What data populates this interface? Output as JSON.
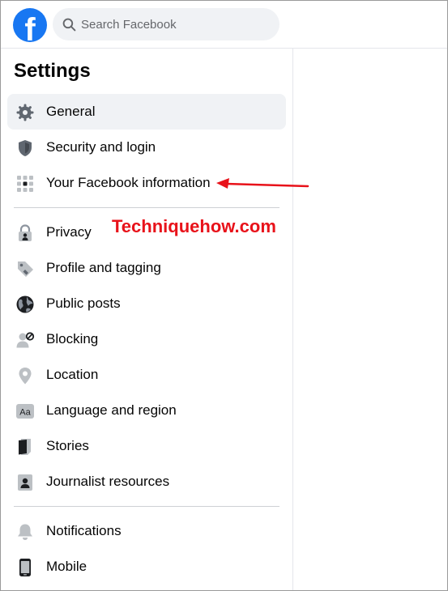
{
  "search": {
    "placeholder": "Search Facebook"
  },
  "sidebar": {
    "title": "Settings",
    "items": [
      {
        "label": "General"
      },
      {
        "label": "Security and login"
      },
      {
        "label": "Your Facebook information"
      },
      {
        "label": "Privacy"
      },
      {
        "label": "Profile and tagging"
      },
      {
        "label": "Public posts"
      },
      {
        "label": "Blocking"
      },
      {
        "label": "Location"
      },
      {
        "label": "Language and region"
      },
      {
        "label": "Stories"
      },
      {
        "label": "Journalist resources"
      },
      {
        "label": "Notifications"
      },
      {
        "label": "Mobile"
      }
    ]
  },
  "watermark": "Techniquehow.com",
  "logo": {
    "glyph": "f"
  },
  "icons": {
    "general": "gear-icon",
    "security": "shield-icon",
    "information": "grid-icon",
    "privacy": "lock-icon",
    "profile_tagging": "tag-icon",
    "public_posts": "globe-icon",
    "blocking": "block-user-icon",
    "location": "location-pin-icon",
    "language": "language-icon",
    "stories": "book-icon",
    "journalist": "badge-icon",
    "notifications": "bell-icon",
    "mobile": "phone-icon"
  },
  "colors": {
    "brand": "#1877f2",
    "annotation": "#e8121a",
    "icon": "#606770"
  }
}
